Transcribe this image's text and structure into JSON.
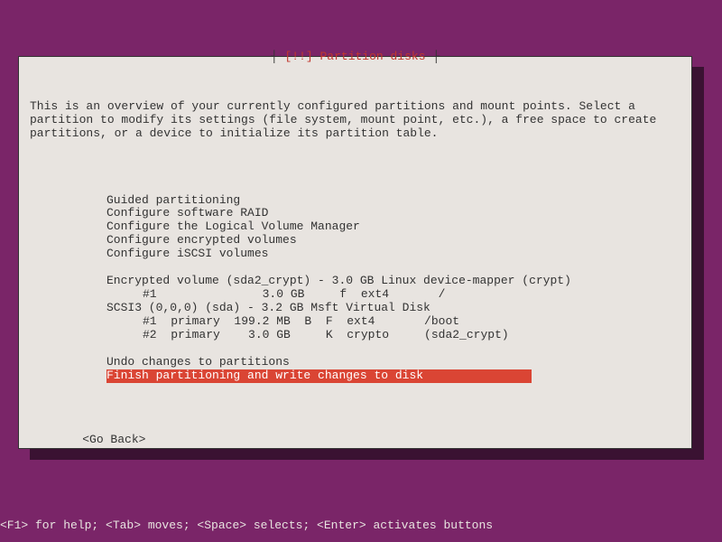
{
  "title_prefix": "┤ ",
  "title_text": "[!!] Partition disks",
  "title_suffix": " ├",
  "instructions": "This is an overview of your currently configured partitions and mount points. Select a partition to modify its settings (file system, mount point, etc.), a free space to create partitions, or a device to initialize its partition table.",
  "menu1": [
    "Guided partitioning",
    "Configure software RAID",
    "Configure the Logical Volume Manager",
    "Configure encrypted volumes",
    "Configure iSCSI volumes"
  ],
  "devices": [
    {
      "header": "Encrypted volume (sda2_crypt) - 3.0 GB Linux device-mapper (crypt)",
      "partitions": [
        "#1               3.0 GB     f  ext4       /"
      ]
    },
    {
      "header": "SCSI3 (0,0,0) (sda) - 3.2 GB Msft Virtual Disk",
      "partitions": [
        "#1  primary  199.2 MB  B  F  ext4       /boot",
        "#2  primary    3.0 GB     K  crypto     (sda2_crypt)"
      ]
    }
  ],
  "menu2": [
    "Undo changes to partitions",
    "Finish partitioning and write changes to disk"
  ],
  "selected_menu2_index": 1,
  "go_back": "<Go Back>",
  "footer": "<F1> for help; <Tab> moves; <Space> selects; <Enter> activates buttons"
}
